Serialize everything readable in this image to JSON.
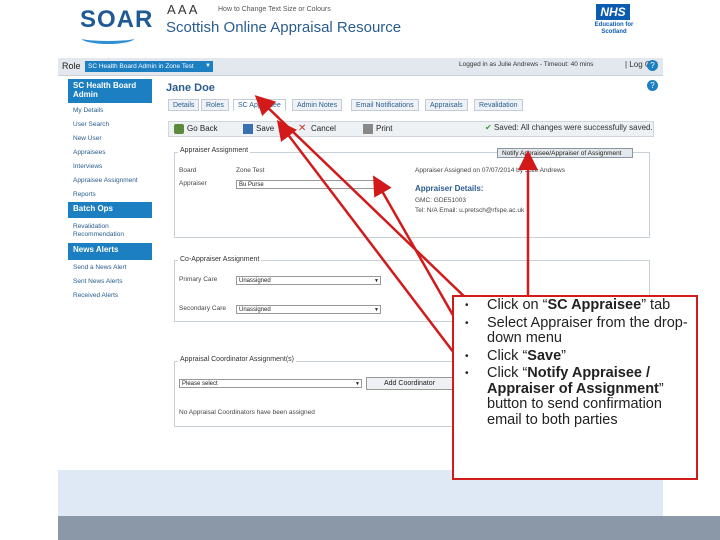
{
  "header": {
    "logo": "SOAR",
    "text_size_label": "A A A",
    "text_size_link": "How to Change Text Size or Colours",
    "title": "Scottish Online Appraisal Resource",
    "nhs_logo": "NHS",
    "nhs_sub": "Education for Scotland"
  },
  "rolebar": {
    "role_label": "Role",
    "role_value": "SC Health Board Admin in Zone Test",
    "logged_in": "Logged in as Julie Andrews - Timeout: 40 mins",
    "logout": "| Log Out"
  },
  "sidebar": {
    "sections": [
      {
        "title": "SC Health Board Admin",
        "items": [
          "My Details",
          "User Search",
          "New User",
          "Appraisees",
          "Interviews",
          "Appraisee Assignment",
          "Reports"
        ]
      },
      {
        "title": "Batch Ops",
        "items": [
          "Revalidation Recommendation"
        ]
      },
      {
        "title": "News Alerts",
        "items": [
          "Send a News Alert",
          "Sent News Alerts",
          "Received Alerts"
        ]
      }
    ]
  },
  "main": {
    "person_name": "Jane Doe",
    "tabs": [
      "Details",
      "Roles",
      "SC Appraisee",
      "Admin Notes",
      "Email Notifications",
      "Appraisals",
      "Revalidation"
    ],
    "toolbar": {
      "go_back": "Go Back",
      "save": "Save",
      "cancel": "Cancel",
      "print": "Print"
    },
    "saved_msg": "Saved: All changes were successfully saved.",
    "appraiser_assignment": {
      "legend": "Appraiser Assignment",
      "board_label": "Board",
      "board_value": "Zone Test",
      "appraiser_label": "Appraiser",
      "appraiser_value": "Bu Purse",
      "assigned_text": "Appraiser Assigned on 07/07/2014 by Julie Andrews",
      "notify_button": "Notify Appraisee/Appraiser of Assignment",
      "details_title": "Appraiser Details:",
      "details_line1": "GMC: GDE51003",
      "details_line2": "Tel: N/A     Email: u.pretsch@rfspe.ac.uk"
    },
    "co_appraiser": {
      "legend": "Co-Appraiser Assignment",
      "primary_label": "Primary Care",
      "primary_value": "Unassigned",
      "secondary_label": "Secondary Care",
      "secondary_value": "Unassigned"
    },
    "coordinator": {
      "legend": "Appraisal Coordinator Assignment(s)",
      "select_value": "Please select",
      "add_button": "Add Coordinator",
      "empty_msg": "No Appraisal Coordinators have been assigned"
    }
  },
  "callout": {
    "items": [
      {
        "prefix": "Click on “",
        "bold": "SC Appraisee",
        "suffix": "” tab"
      },
      {
        "prefix": "Select Appraiser from the drop-down menu",
        "bold": "",
        "suffix": ""
      },
      {
        "prefix": "Click “",
        "bold": "Save",
        "suffix": "”"
      },
      {
        "prefix": "Click “",
        "bold": "Notify Appraisee / Appraiser of Assignment",
        "suffix": "” button to send confirmation email to both parties"
      }
    ]
  },
  "colors": {
    "brand_blue": "#1c7fc1",
    "callout_red": "#d21a1a",
    "title_blue": "#2a5c8e"
  }
}
